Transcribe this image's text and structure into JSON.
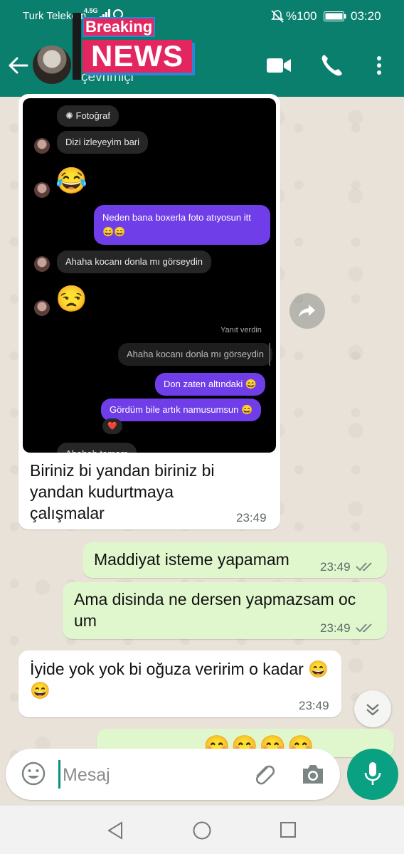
{
  "status_bar": {
    "carrier": "Turk Telekom",
    "network": "4.5G",
    "battery": "%100",
    "time": "03:20"
  },
  "header": {
    "contact_status": "çevrimiçi",
    "overlay_badge_top": "Breaking",
    "overlay_badge_main": "NEWS",
    "icons": [
      "back-arrow",
      "avatar",
      "video-call",
      "voice-call",
      "more-vert"
    ],
    "accent_color": "#0b7f6e"
  },
  "embedded_screenshot": {
    "top_label": "Fotoğraf",
    "messages": [
      {
        "side": "in",
        "text": "Dizi izleyeyim bari"
      },
      {
        "side": "in",
        "emoji": "😂"
      },
      {
        "side": "out",
        "text": "Neden bana boxerla foto atıyosun itt",
        "emoji": "😄😄"
      },
      {
        "side": "in",
        "text": "Ahaha kocanı donla mı görseydin"
      },
      {
        "side": "in",
        "emoji": "😒"
      },
      {
        "side": "meta",
        "text": "Yanıt verdin"
      },
      {
        "side": "quote",
        "text": "Ahaha kocanı donla mı görseydin"
      },
      {
        "side": "out",
        "text": "Don zaten altındaki 😄"
      },
      {
        "side": "out",
        "text": "Gördüm bile artık namusumsun 😄"
      },
      {
        "side": "reaction",
        "text": "❤️"
      },
      {
        "side": "in",
        "text": "Ahahah tamam"
      }
    ]
  },
  "messages": [
    {
      "side": "in",
      "text": "Biriniz bi yandan biriniz bi yandan kudurtmaya çalışmalar",
      "time": "23:49"
    },
    {
      "side": "out",
      "text": "Maddiyat isteme yapamam",
      "time": "23:49"
    },
    {
      "side": "out",
      "text": "Ama disinda ne dersen yapmazsam oc um",
      "time": "23:49"
    },
    {
      "side": "in",
      "text": "İyide yok yok bi oğuza veririm o kadar 😄😄",
      "time": "23:49"
    },
    {
      "side": "out",
      "text": "😊😊😊😊",
      "time": ""
    }
  ],
  "input": {
    "placeholder": "Mesaj"
  },
  "nav_bar": {
    "icons": [
      "back-triangle",
      "home-circle",
      "recents-square"
    ]
  }
}
